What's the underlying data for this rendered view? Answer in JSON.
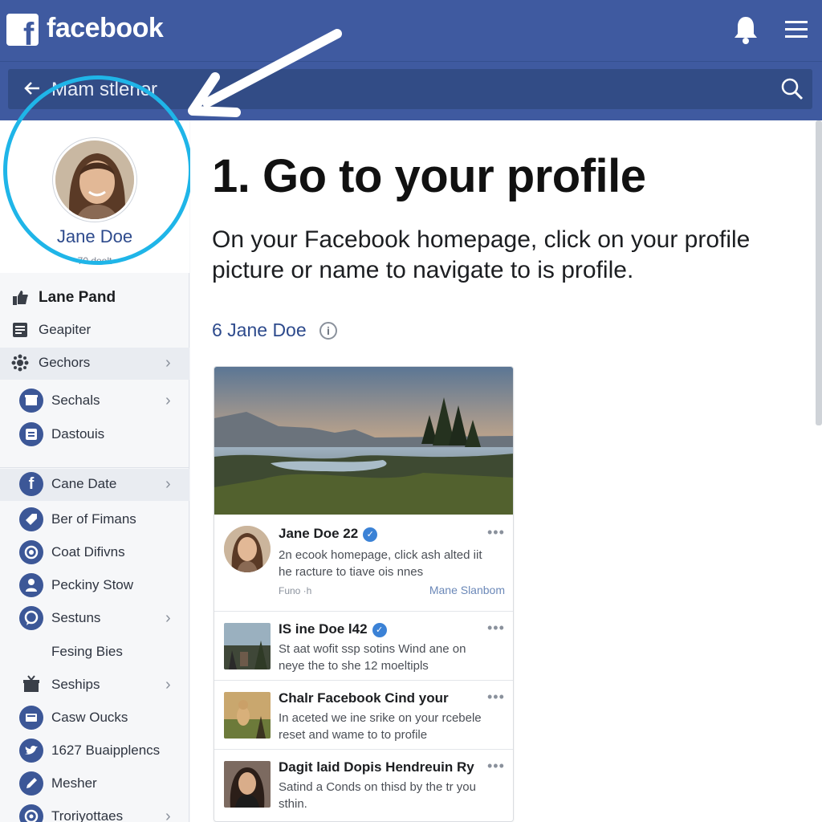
{
  "header": {
    "logo_letter": "f",
    "brand": "facebook",
    "bell_icon": "bell-icon",
    "menu_icon": "hamburger-menu-icon"
  },
  "search": {
    "value": "Mam stlenor",
    "back_icon": "arrow-left-icon",
    "search_icon": "search-icon"
  },
  "profile": {
    "name": "Jane Doe",
    "subtitle": "70 doolt"
  },
  "sidebar": {
    "items": [
      {
        "label": "Lane Pand",
        "icon": "thumbs-up-icon"
      },
      {
        "label": "Geapiter",
        "icon": "news-feed-icon"
      },
      {
        "label": "Gechors",
        "icon": "settings-gear-icon"
      },
      {
        "label": "Sechals",
        "icon": "marketplace-icon"
      },
      {
        "label": "Dastouis",
        "icon": "pages-icon"
      },
      {
        "label": "Cane Date",
        "icon": "facebook-f-icon"
      },
      {
        "label": "Ber of Fimans",
        "icon": "tag-icon"
      },
      {
        "label": "Coat Difivns",
        "icon": "camera-icon"
      },
      {
        "label": "Peckiny Stow",
        "icon": "person-icon"
      },
      {
        "label": "Sestuns",
        "icon": "messenger-icon"
      },
      {
        "label": "Fesing Bies"
      },
      {
        "label": "Seships",
        "icon": "gift-box-icon"
      },
      {
        "label": "Casw Oucks",
        "icon": "video-icon"
      },
      {
        "label": "1627 Buaipplencs",
        "icon": "twitter-bird-icon"
      },
      {
        "label": "Mesher",
        "icon": "pencil-icon"
      },
      {
        "label": "Troriyottaes",
        "icon": "globe-icon"
      }
    ]
  },
  "main": {
    "step_title": "1. Go to your profile",
    "step_description": "On your Facebook homepage, click on your profile picture or name to navigate to is profile.",
    "name_line": "6 Jane Doe",
    "info_glyph": "i"
  },
  "feed": {
    "posts": [
      {
        "title": "Jane Doe 22",
        "text": "2n ecook homepage, click ash alted iit he racture to tiave ois nnes",
        "meta": "Funo ·h",
        "link": "Mane Slanbom"
      },
      {
        "title": "IS ine Doe l42",
        "text": "St aat wofit ssp sotins Wind ane on neye the to she 12 moeltipls"
      },
      {
        "title": "Chalr Facebook Cind your",
        "text": "In aceted we ine srike on your rcebele reset and wame to to profile"
      },
      {
        "title": "Dagit laid Dopis Hendreuin Ry",
        "text": "Satind a Conds on thisd by the tr you sthin."
      }
    ],
    "verified_glyph": "✓",
    "more_glyph": "•••"
  },
  "colors": {
    "brand_blue": "#3f5aa0",
    "highlight_ring": "#1fb5e8",
    "link_blue": "#2d4a8c"
  }
}
